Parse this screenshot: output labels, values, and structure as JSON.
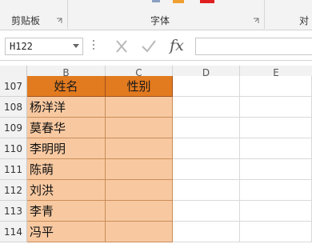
{
  "ribbon": {
    "groups": [
      {
        "label": "剪贴板"
      },
      {
        "label": "字体"
      },
      {
        "label": "对"
      }
    ],
    "accent_colors": {
      "fill": "#f0a030",
      "font": "#e02020"
    }
  },
  "formula_bar": {
    "name_box": "H122",
    "cancel_icon": "close-icon",
    "enter_icon": "check-icon",
    "function_label": "fx",
    "formula": ""
  },
  "sheet": {
    "columns": [
      "B",
      "C",
      "D",
      "E"
    ],
    "rows": [
      {
        "num": "107",
        "b": "姓名",
        "c": "性别"
      },
      {
        "num": "108",
        "b": "杨洋洋",
        "c": ""
      },
      {
        "num": "109",
        "b": "莫春华",
        "c": ""
      },
      {
        "num": "110",
        "b": "李明明",
        "c": ""
      },
      {
        "num": "111",
        "b": "陈萌",
        "c": ""
      },
      {
        "num": "112",
        "b": "刘洪",
        "c": ""
      },
      {
        "num": "113",
        "b": "李青",
        "c": ""
      },
      {
        "num": "114",
        "b": "冯平",
        "c": ""
      }
    ],
    "colors": {
      "header_fill": "#e27a1f",
      "data_fill": "#f8c9a1"
    }
  }
}
